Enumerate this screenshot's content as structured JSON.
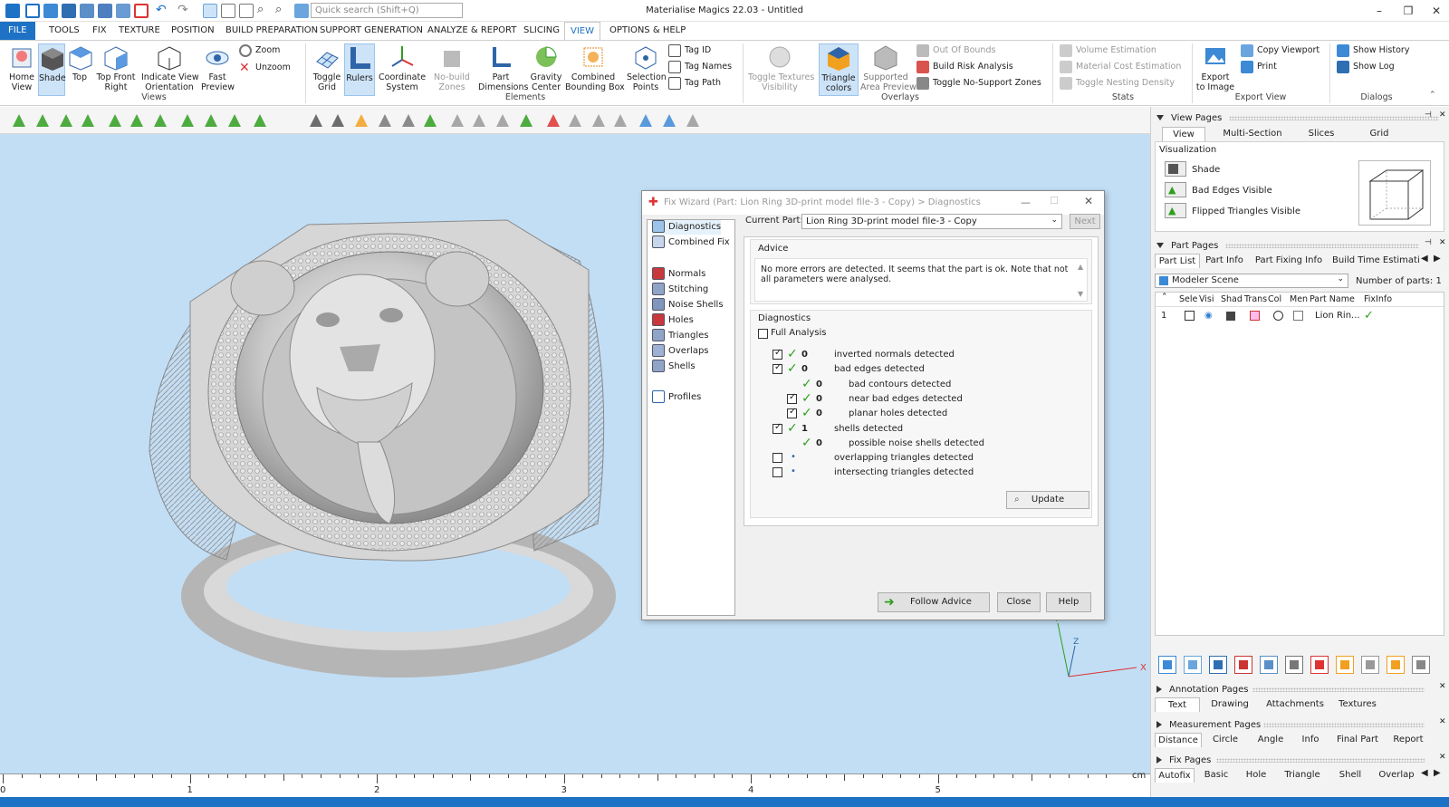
{
  "window": {
    "title": "Materialise Magics 22.03 - Untitled",
    "search_placeholder": "Quick search (Shift+Q)"
  },
  "menu": {
    "tabs": [
      "FILE",
      "TOOLS",
      "FIX",
      "TEXTURE",
      "POSITION",
      "BUILD PREPARATION",
      "SUPPORT GENERATION",
      "ANALYZE & REPORT",
      "SLICING",
      "VIEW",
      "OPTIONS & HELP"
    ],
    "active": "VIEW"
  },
  "ribbon": {
    "views": {
      "home": "Home\nView",
      "shade": "Shade",
      "top": "Top",
      "tfr": "Top Front\nRight",
      "indicate": "Indicate View\nOrientation",
      "fast": "Fast\nPreview",
      "zoom": "Zoom",
      "unzoom": "Unzoom",
      "group": "Views"
    },
    "elements": {
      "grid": "Toggle\nGrid",
      "rulers": "Rulers",
      "coord": "Coordinate\nSystem",
      "nobuild": "No-build\nZones",
      "dims": "Part\nDimensions",
      "gravity": "Gravity\nCenter",
      "bbox": "Combined\nBounding Box",
      "selpts": "Selection\nPoints",
      "tagid": "Tag ID",
      "tagnames": "Tag Names",
      "tagpath": "Tag Path",
      "group": "Elements"
    },
    "overlays": {
      "textures": "Toggle Textures\nVisibility",
      "tricolors": "Triangle\ncolors",
      "supported": "Supported\nArea Preview",
      "outofbounds": "Out Of Bounds",
      "buildrisk": "Build Risk Analysis",
      "nosupport": "Toggle No-Support Zones",
      "group": "Overlays"
    },
    "stats": {
      "volume": "Volume Estimation",
      "material": "Material Cost Estimation",
      "nesting": "Toggle Nesting Density",
      "group": "Stats"
    },
    "export": {
      "image": "Export\nto Image",
      "copy": "Copy Viewport",
      "print": "Print",
      "group": "Export View"
    },
    "dialogs": {
      "history": "Show History",
      "log": "Show Log",
      "group": "Dialogs"
    }
  },
  "dialog": {
    "title": "Fix Wizard (Part: Lion Ring 3D-print model file-3 - Copy) > Diagnostics",
    "nav": [
      "Diagnostics",
      "Combined Fix",
      "Normals",
      "Stitching",
      "Noise Shells",
      "Holes",
      "Triangles",
      "Overlaps",
      "Shells",
      "Profiles"
    ],
    "current_part_label": "Current Part:",
    "current_part": "Lion Ring 3D-print model file-3 - Copy",
    "next": "Next",
    "advice_label": "Advice",
    "advice_text": "No more errors are detected. It seems that the part is ok. Note that not all parameters were analysed.",
    "diagnostics_label": "Diagnostics",
    "full_analysis": "Full Analysis",
    "rows": [
      {
        "label": "inverted normals detected",
        "count": "0",
        "checked": true,
        "ok": true,
        "indent": 0
      },
      {
        "label": "bad edges detected",
        "count": "0",
        "checked": true,
        "ok": true,
        "indent": 0
      },
      {
        "label": "bad contours detected",
        "count": "0",
        "checked": false,
        "ok": true,
        "indent": 1,
        "nobox": true
      },
      {
        "label": "near bad edges detected",
        "count": "0",
        "checked": true,
        "ok": true,
        "indent": 1
      },
      {
        "label": "planar holes detected",
        "count": "0",
        "checked": true,
        "ok": true,
        "indent": 1
      },
      {
        "label": "shells detected",
        "count": "1",
        "checked": true,
        "ok": true,
        "indent": 0
      },
      {
        "label": "possible noise shells detected",
        "count": "0",
        "checked": false,
        "ok": true,
        "indent": 1,
        "nobox": true
      },
      {
        "label": "overlapping triangles detected",
        "count": "",
        "checked": false,
        "ok": false,
        "indent": 0
      },
      {
        "label": "intersecting triangles detected",
        "count": "",
        "checked": false,
        "ok": false,
        "indent": 0
      }
    ],
    "update": "Update",
    "follow_advice": "Follow Advice",
    "close": "Close",
    "help": "Help"
  },
  "right_panel": {
    "view_pages": "View Pages",
    "view_tabs": [
      "View",
      "Multi-Section",
      "Slices",
      "Grid"
    ],
    "visualization": "Visualization",
    "vis_items": [
      "Shade",
      "Bad Edges Visible",
      "Flipped Triangles Visible"
    ],
    "part_pages": "Part Pages",
    "part_tabs": [
      "Part List",
      "Part Info",
      "Part Fixing Info",
      "Build Time Estimation"
    ],
    "scene": "Modeler Scene",
    "num_parts_label": "Number of parts:",
    "num_parts": "1",
    "columns": [
      "Sele",
      "Visi",
      "Shad",
      "Trans",
      "Col",
      "Men",
      "Part Name",
      "FixInfo"
    ],
    "part_row": {
      "index": "1",
      "name": "Lion Rin..."
    },
    "annotation_pages": "Annotation Pages",
    "annotation_tabs": [
      "Text",
      "Drawing",
      "Attachments",
      "Textures"
    ],
    "measurement_pages": "Measurement Pages",
    "measurement_tabs": [
      "Distance",
      "Circle",
      "Angle",
      "Info",
      "Final Part",
      "Report"
    ],
    "fix_pages": "Fix Pages",
    "fix_tabs": [
      "Autofix",
      "Basic",
      "Hole",
      "Triangle",
      "Shell",
      "Overlap"
    ]
  },
  "ruler": {
    "labels": [
      "0",
      "1",
      "2",
      "3",
      "4",
      "5"
    ],
    "unit": "cm"
  },
  "colors": {
    "accent": "#1e72c5",
    "viewport": "#c2def5",
    "ok": "#2f9e1f"
  }
}
